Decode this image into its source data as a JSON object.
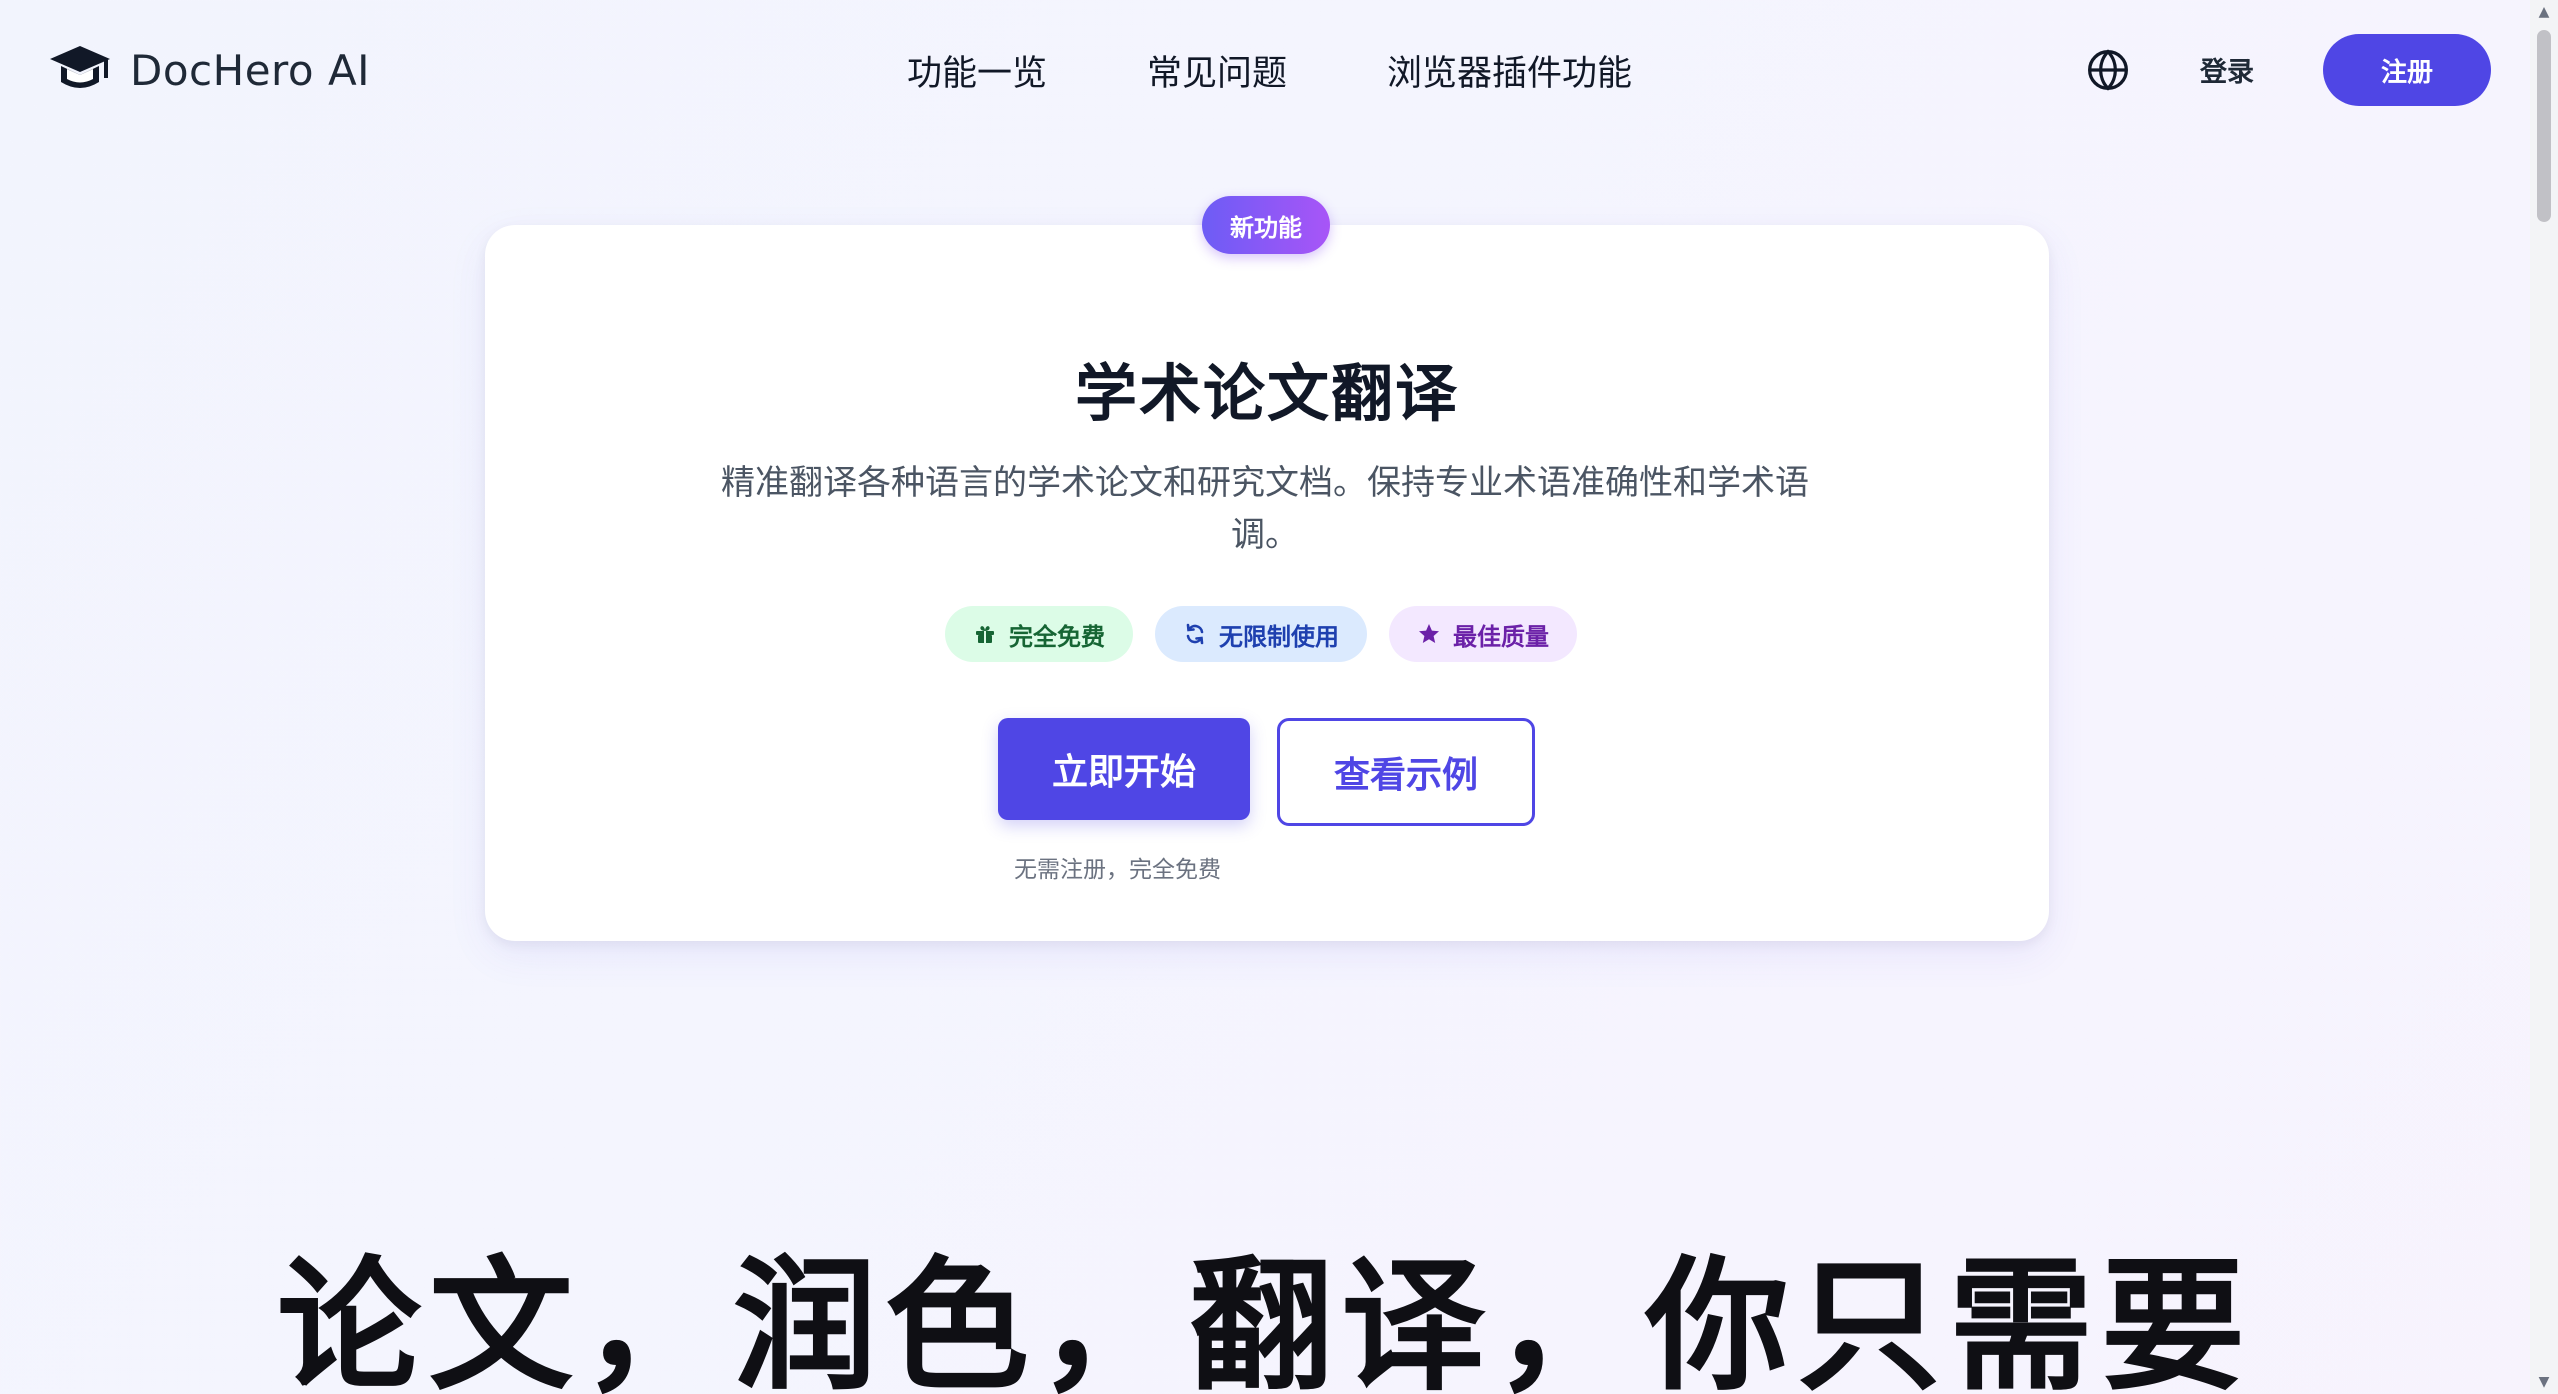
{
  "brand": {
    "name": "DocHero AI",
    "icon": "graduation-cap-icon"
  },
  "nav": {
    "items": [
      {
        "label": "功能一览"
      },
      {
        "label": "常见问题"
      },
      {
        "label": "浏览器插件功能"
      }
    ]
  },
  "header": {
    "language_icon": "globe-icon",
    "login_label": "登录",
    "signup_label": "注册"
  },
  "hero": {
    "badge": "新功能",
    "title": "学术论文翻译",
    "description": "精准翻译各种语言的学术论文和研究文档。保持专业术语准确性和学术语调。",
    "pills": [
      {
        "label": "完全免费",
        "icon": "gift-icon",
        "color": "#166534"
      },
      {
        "label": "无限制使用",
        "icon": "refresh-icon",
        "color": "#1e40af"
      },
      {
        "label": "最佳质量",
        "icon": "star-icon",
        "color": "#6b21a8"
      }
    ],
    "primary_button": "立即开始",
    "secondary_button": "查看示例",
    "hint": "无需注册，完全免费"
  },
  "headline": "论文，润色，翻译，你只需要",
  "colors": {
    "accent": "#4f46e5",
    "badge_gradient_start": "#6d5cf5",
    "badge_gradient_end": "#a855f7",
    "text": "#111827"
  }
}
